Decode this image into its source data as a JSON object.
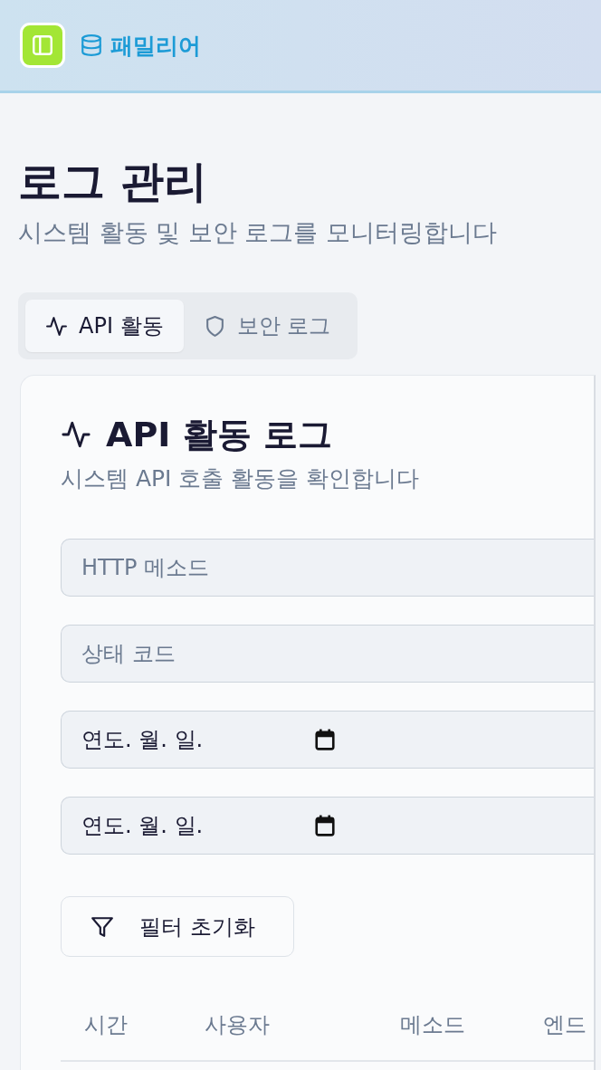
{
  "app_bar": {
    "brand": "패밀리어"
  },
  "page": {
    "title": "로그 관리",
    "subtitle": "시스템 활동 및 보안 로그를 모니터링합니다"
  },
  "tabs": [
    {
      "kind": "activity",
      "label": "API 활동",
      "selected": true
    },
    {
      "kind": "security",
      "label": "보안 로그",
      "selected": false
    }
  ],
  "card": {
    "title": "API 활동 로그",
    "subtitle": "시스템 API 호출 활동을 확인합니다",
    "filters": [
      {
        "kind": "text",
        "placeholder": "HTTP 메소드"
      },
      {
        "kind": "text",
        "placeholder": "상태 코드"
      },
      {
        "kind": "date",
        "value": "연도. 월. 일."
      },
      {
        "kind": "date",
        "value": "연도. 월. 일."
      }
    ],
    "reset_button": {
      "label": "필터 초기화"
    },
    "table": {
      "columns": [
        "시간",
        "사용자",
        "메소드",
        "엔드"
      ]
    }
  }
}
